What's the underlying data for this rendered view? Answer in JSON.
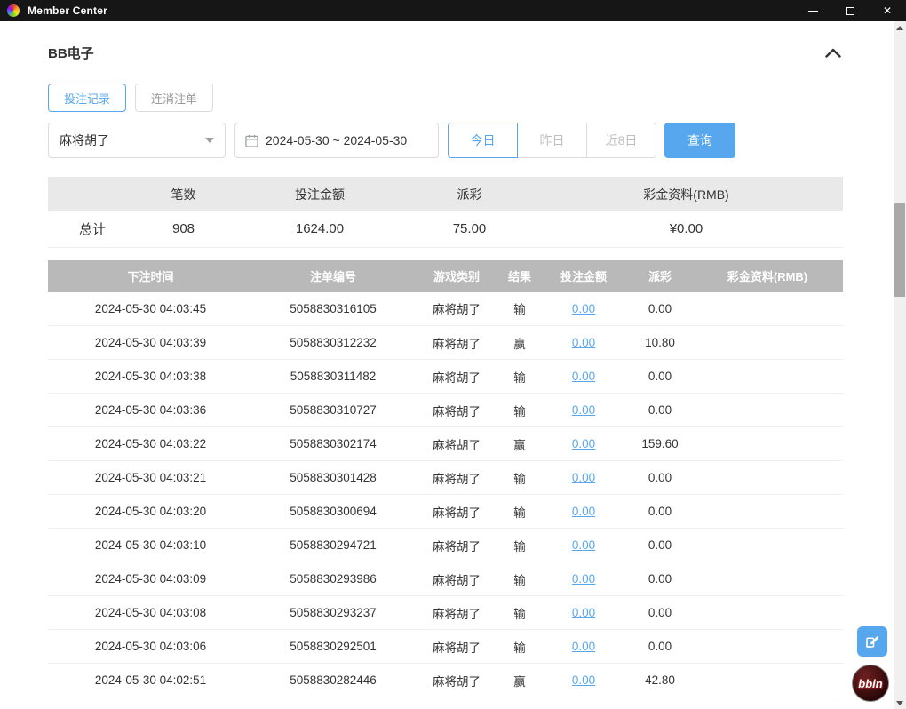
{
  "window": {
    "title": "Member Center"
  },
  "section": {
    "title": "BB电子"
  },
  "tabs": [
    {
      "label": "投注记录",
      "active": true
    },
    {
      "label": "连消注单",
      "active": false
    }
  ],
  "filters": {
    "game_select_value": "麻将胡了",
    "date_range_value": "2024-05-30 ~ 2024-05-30",
    "quick_ranges": [
      {
        "label": "今日",
        "active": true
      },
      {
        "label": "昨日",
        "active": false
      },
      {
        "label": "近8日",
        "active": false
      }
    ],
    "search_label": "查询"
  },
  "summary": {
    "headers": [
      "",
      "笔数",
      "投注金额",
      "派彩",
      "彩金资料(RMB)"
    ],
    "total_label": "总计",
    "count": "908",
    "bet_amount": "1624.00",
    "payout": "75.00",
    "bonus": "¥0.00"
  },
  "records": {
    "headers": [
      "下注时间",
      "注单编号",
      "游戏类别",
      "结果",
      "投注金额",
      "派彩",
      "彩金资料(RMB)"
    ],
    "rows": [
      {
        "time": "2024-05-30 04:03:45",
        "order": "5058830316105",
        "game": "麻将胡了",
        "result": "输",
        "bet": "0.00",
        "payout": "0.00",
        "bonus": ""
      },
      {
        "time": "2024-05-30 04:03:39",
        "order": "5058830312232",
        "game": "麻将胡了",
        "result": "赢",
        "bet": "0.00",
        "payout": "10.80",
        "bonus": ""
      },
      {
        "time": "2024-05-30 04:03:38",
        "order": "5058830311482",
        "game": "麻将胡了",
        "result": "输",
        "bet": "0.00",
        "payout": "0.00",
        "bonus": ""
      },
      {
        "time": "2024-05-30 04:03:36",
        "order": "5058830310727",
        "game": "麻将胡了",
        "result": "输",
        "bet": "0.00",
        "payout": "0.00",
        "bonus": ""
      },
      {
        "time": "2024-05-30 04:03:22",
        "order": "5058830302174",
        "game": "麻将胡了",
        "result": "赢",
        "bet": "0.00",
        "payout": "159.60",
        "bonus": ""
      },
      {
        "time": "2024-05-30 04:03:21",
        "order": "5058830301428",
        "game": "麻将胡了",
        "result": "输",
        "bet": "0.00",
        "payout": "0.00",
        "bonus": ""
      },
      {
        "time": "2024-05-30 04:03:20",
        "order": "5058830300694",
        "game": "麻将胡了",
        "result": "输",
        "bet": "0.00",
        "payout": "0.00",
        "bonus": ""
      },
      {
        "time": "2024-05-30 04:03:10",
        "order": "5058830294721",
        "game": "麻将胡了",
        "result": "输",
        "bet": "0.00",
        "payout": "0.00",
        "bonus": ""
      },
      {
        "time": "2024-05-30 04:03:09",
        "order": "5058830293986",
        "game": "麻将胡了",
        "result": "输",
        "bet": "0.00",
        "payout": "0.00",
        "bonus": ""
      },
      {
        "time": "2024-05-30 04:03:08",
        "order": "5058830293237",
        "game": "麻将胡了",
        "result": "输",
        "bet": "0.00",
        "payout": "0.00",
        "bonus": ""
      },
      {
        "time": "2024-05-30 04:03:06",
        "order": "5058830292501",
        "game": "麻将胡了",
        "result": "输",
        "bet": "0.00",
        "payout": "0.00",
        "bonus": ""
      },
      {
        "time": "2024-05-30 04:02:51",
        "order": "5058830282446",
        "game": "麻将胡了",
        "result": "赢",
        "bet": "0.00",
        "payout": "42.80",
        "bonus": ""
      }
    ]
  },
  "floating": {
    "bbin_label": "bbin"
  },
  "colors": {
    "accent": "#57a7ee",
    "titlebar": "#161616",
    "table_header": "#b9b9b9",
    "link": "#57a7ee"
  }
}
